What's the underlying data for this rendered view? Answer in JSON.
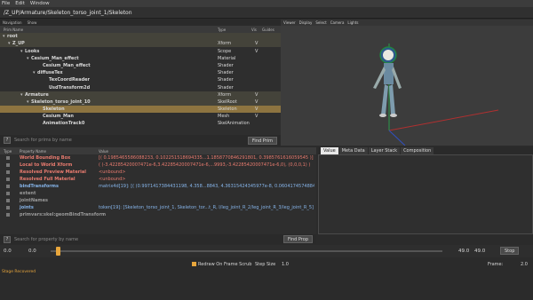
{
  "menu": [
    "File",
    "Edit",
    "Window"
  ],
  "path": "/Z_UP/Armature/Skeleton_torso_joint_1/Skeleton",
  "tree_tabs": [
    "Navigation",
    "Show"
  ],
  "tree_headers": {
    "name": "Prim Name",
    "type": "Type",
    "vis": "Vis",
    "guides": "Guides"
  },
  "tree_rows": [
    {
      "name": "root",
      "type": "",
      "vis": "",
      "twisty": "▾",
      "style": "hl"
    },
    {
      "name": "Z_UP",
      "type": "Xform",
      "vis": "V",
      "twisty": "▾",
      "style": "hl"
    },
    {
      "name": "Looks",
      "type": "Scope",
      "vis": "V",
      "twisty": "▾",
      "style": ""
    },
    {
      "name": "Cesium_Man_effect",
      "type": "Material",
      "vis": "",
      "twisty": "▾",
      "style": ""
    },
    {
      "name": "Cesium_Man_effect",
      "type": "Shader",
      "vis": "",
      "twisty": "",
      "style": ""
    },
    {
      "name": "diffuseTex",
      "type": "Shader",
      "vis": "",
      "twisty": "▾",
      "style": ""
    },
    {
      "name": "TexCoordReader",
      "type": "Shader",
      "vis": "",
      "twisty": "",
      "style": ""
    },
    {
      "name": "UsdTransform2d",
      "type": "Shader",
      "vis": "",
      "twisty": "",
      "style": ""
    },
    {
      "name": "Armature",
      "type": "Xform",
      "vis": "V",
      "twisty": "▾",
      "style": "hl"
    },
    {
      "name": "Skeleton_torso_joint_10",
      "type": "SkelRoot",
      "vis": "V",
      "twisty": "▾",
      "style": "hl"
    },
    {
      "name": "Skeleton",
      "type": "Skeleton",
      "vis": "V",
      "twisty": "",
      "style": "sel"
    },
    {
      "name": "Cesium_Man",
      "type": "Mesh",
      "vis": "V",
      "twisty": "",
      "style": ""
    },
    {
      "name": "AnimationTrack0",
      "type": "SkelAnimation",
      "vis": "",
      "twisty": "",
      "style": ""
    }
  ],
  "prim_search": {
    "help": "?",
    "placeholder": "Search for prims by name",
    "button": "Find Prim"
  },
  "viewport_tabs": [
    "Viewer",
    "Display",
    "Select",
    "Camera",
    "Lights"
  ],
  "prop_headers": {
    "type": "Type",
    "name": "Property Name",
    "value": "Value"
  },
  "prop_rows": [
    {
      "name": "World Bounding Box",
      "value": "[( 0.1985465586088233, 0.102251518694335...1.1858770846291801, 0.3985761616059545 )]",
      "cls": "red"
    },
    {
      "name": "Local to World Xform",
      "value": "( (-3.42285420007471e-6,3.42285420007471e-6,...9993,-3.42285420007471e-6,0), (0,0,0,1) )",
      "cls": "red"
    },
    {
      "name": "Resolved Preview Material",
      "value": "<unbound>",
      "cls": "red"
    },
    {
      "name": "Resolved Full Material",
      "value": "<unbound>",
      "cls": "red"
    },
    {
      "name": "bindTransforms",
      "value": "matrix4d[19]: [( (0.9971417384431198, 4.358...8843, 4.36315424345977e-8, 0.0604174574884",
      "cls": "blue"
    },
    {
      "name": "extent",
      "value": "",
      "cls": "grey"
    },
    {
      "name": "jointNames",
      "value": "",
      "cls": "grey"
    },
    {
      "name": "joints",
      "value": "token[19]: [Skeleton_torso_joint_1, Skeleton_tor...t_R, l/leg_joint_R_2/leg_joint_R_3/leg_joint_R_5]",
      "cls": "blue"
    },
    {
      "name": "primvars:skel:geomBindTransform",
      "value": "",
      "cls": "grey"
    }
  ],
  "right_tabs": [
    "Value",
    "Meta Data",
    "Layer Stack",
    "Composition"
  ],
  "prop_search": {
    "help": "?",
    "placeholder": "Search for property by name",
    "button": "Find Prop"
  },
  "timeline": {
    "start": "0.0",
    "end": "0.0",
    "current": "49.0",
    "end2": "49.0",
    "stop": "Stop"
  },
  "playback": {
    "redraw": "Redraw On Frame Scrub",
    "step_label": "Step Size",
    "step": "1.0",
    "frame_label": "Frame:",
    "frame": "2.0"
  },
  "status": "Stage Recovered"
}
